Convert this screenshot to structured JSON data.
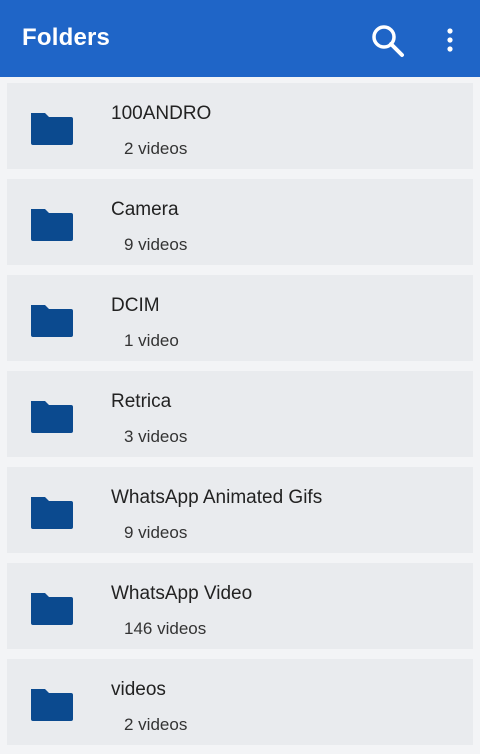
{
  "app_bar": {
    "title": "Folders",
    "background": "#1f65c7",
    "actions": [
      "search-icon",
      "more-vert-icon"
    ]
  },
  "folders": [
    {
      "name": "100ANDRO",
      "count": "2 videos"
    },
    {
      "name": "Camera",
      "count": "9 videos"
    },
    {
      "name": "DCIM",
      "count": "1 video"
    },
    {
      "name": "Retrica",
      "count": "3 videos"
    },
    {
      "name": "WhatsApp Animated Gifs",
      "count": "9 videos"
    },
    {
      "name": "WhatsApp Video",
      "count": "146 videos"
    },
    {
      "name": "videos",
      "count": "2 videos"
    }
  ],
  "colors": {
    "folder_icon": "#0b4a8f",
    "row_background": "#e9ebee"
  }
}
